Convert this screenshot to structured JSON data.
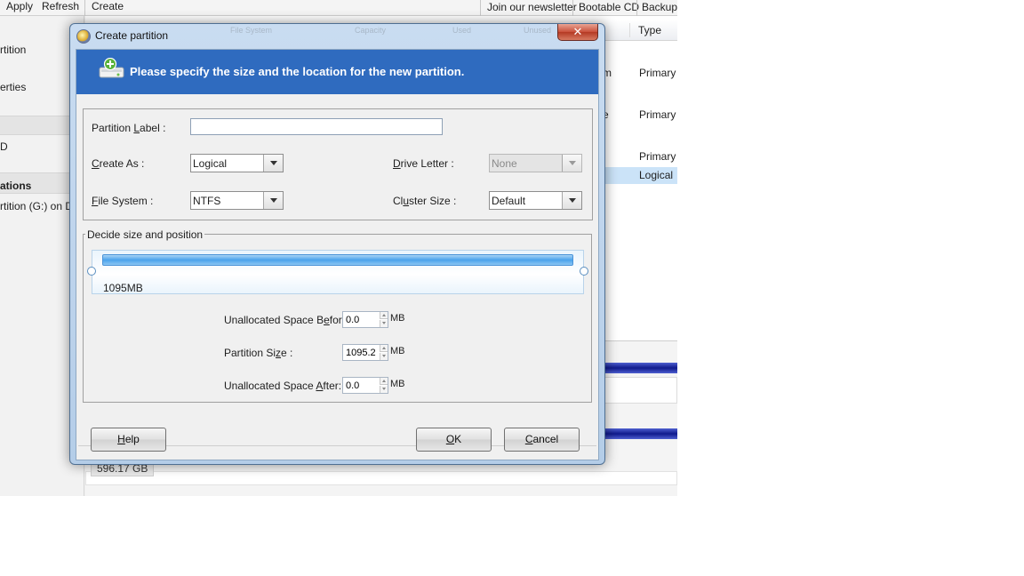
{
  "app": {
    "toolbar": {
      "apply": "Apply",
      "refresh": "Refresh",
      "create": "Create",
      "newsletter": "Join our newsletter",
      "bootable_cd": "Bootable CD",
      "backup": "Backup f"
    },
    "sidebar": {
      "item1": "rtition",
      "item2": "erties",
      "item3": "D",
      "section": "ations",
      "op1": "rtition (G:) on Dis"
    },
    "list": {
      "type_header": "Type",
      "row_frags": [
        "m",
        "e"
      ],
      "rows": [
        "Primary",
        "Primary",
        "Primary",
        "Logical"
      ]
    },
    "disk_size": "596.17 GB"
  },
  "dialog": {
    "title": "Create partition",
    "close_glyph": "✕",
    "faint_columns": [
      "File System",
      "Capacity",
      "Used",
      "Unused"
    ],
    "banner_text": "Please specify the size and the location for the new partition.",
    "partition_label": {
      "pre": "Partition ",
      "key": "L",
      "post": "abel :",
      "value": ""
    },
    "create_as": {
      "pre": "",
      "key": "C",
      "post": "reate As :",
      "value": "Logical"
    },
    "drive_letter": {
      "pre": "",
      "key": "D",
      "post": "rive Letter :",
      "value": "None"
    },
    "file_system": {
      "pre": "",
      "key": "F",
      "post": "ile System :",
      "value": "NTFS"
    },
    "cluster_size": {
      "pre": "Cl",
      "key": "u",
      "post": "ster Size :",
      "value": "Default"
    },
    "size_group_title": "Decide size and position",
    "slider_size": "1095MB",
    "slider_fill_fraction": 1.0,
    "space_before": {
      "pre": "Unallocated Space B",
      "key": "e",
      "post": "fore:",
      "value": "0.0",
      "unit": "MB"
    },
    "partition_size": {
      "pre": "Partition Si",
      "key": "z",
      "post": "e :",
      "value": "1095.2",
      "unit": "MB"
    },
    "space_after": {
      "pre": "Unallocated Space ",
      "key": "A",
      "post": "fter:",
      "value": "0.0",
      "unit": "MB"
    },
    "buttons": {
      "help": {
        "key": "H",
        "post": "elp"
      },
      "ok": {
        "key": "O",
        "post": "K"
      },
      "cancel": {
        "key": "C",
        "post": "ancel"
      }
    }
  }
}
